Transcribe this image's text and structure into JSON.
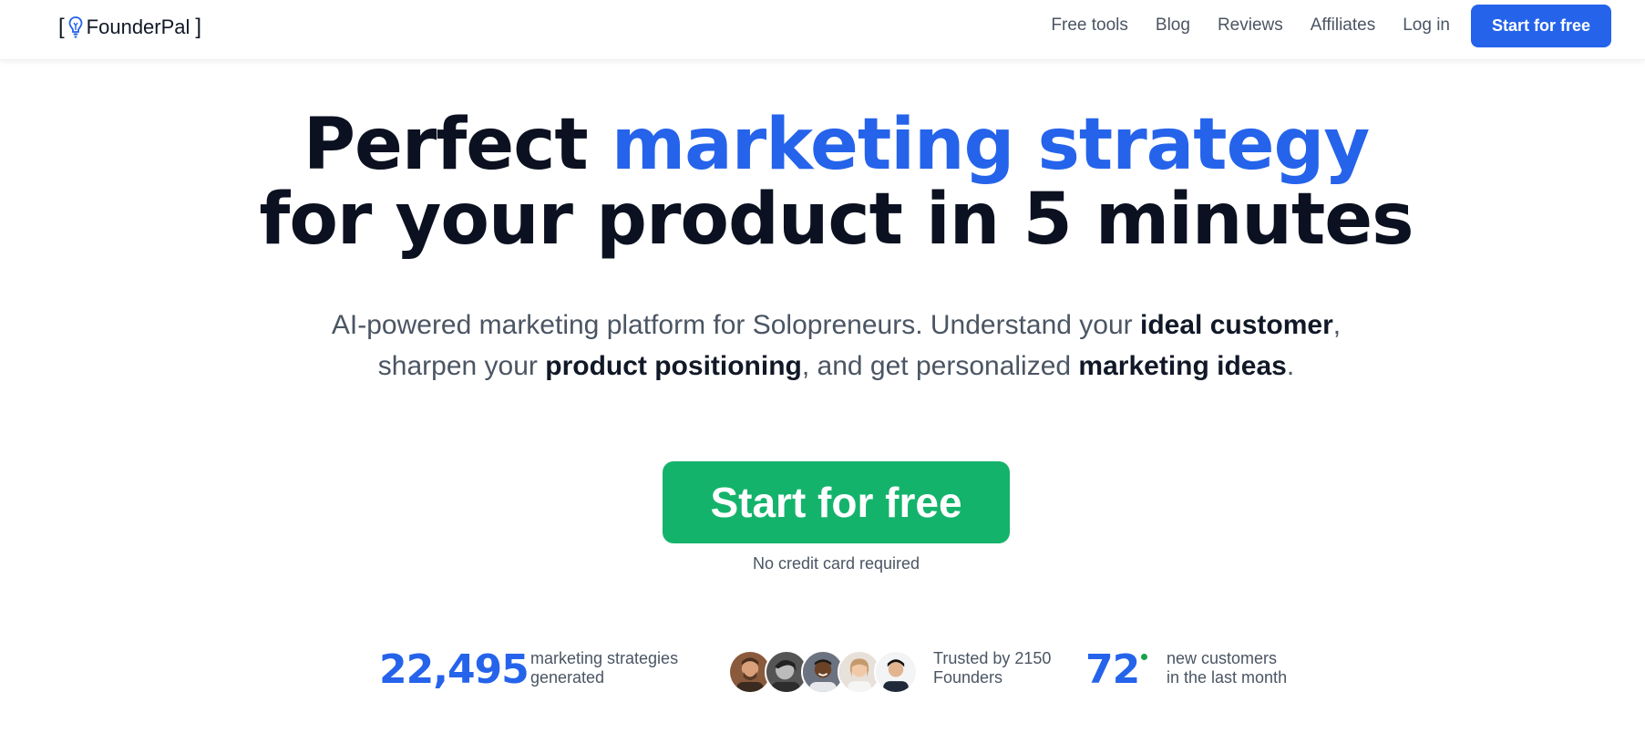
{
  "header": {
    "logo": {
      "bracket_open": "[",
      "name": "FounderPal",
      "bracket_close": "]",
      "icon": "lightbulb-icon"
    },
    "nav": [
      {
        "label": "Free tools"
      },
      {
        "label": "Blog"
      },
      {
        "label": "Reviews"
      },
      {
        "label": "Affiliates"
      },
      {
        "label": "Log in"
      }
    ],
    "cta_label": "Start for free"
  },
  "hero": {
    "title_part1": "Perfect ",
    "title_accent": "marketing strategy",
    "title_line2": "for your product in 5 minutes",
    "subtitle": {
      "t1": "AI-powered marketing platform for Solopreneurs. Understand your ",
      "b1": "ideal customer",
      "t2": ",",
      "t3": "sharpen your ",
      "b2": "product positioning",
      "t4": ", and get personalized ",
      "b3": "marketing ideas",
      "t5": "."
    },
    "cta_label": "Start for free",
    "cta_note": "No credit card required"
  },
  "stats": {
    "strategies": {
      "value": "22,495",
      "label_line1": "marketing strategies",
      "label_line2": "generated"
    },
    "trusted": {
      "label_line1": "Trusted by 2150",
      "label_line2": "Founders",
      "avatar_count": 5
    },
    "customers": {
      "value": "72",
      "label_line1": "new customers",
      "label_line2": "in the last month",
      "live_indicator_color": "#16a34a"
    }
  },
  "colors": {
    "brand_blue": "#2563eb",
    "cta_green": "#14b36b",
    "text_dark": "#0b1120",
    "text_muted": "#4b5563"
  }
}
